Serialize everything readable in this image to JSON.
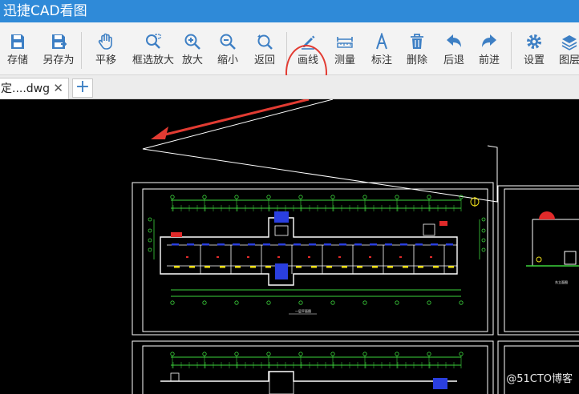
{
  "window": {
    "title": "迅捷CAD看图"
  },
  "toolbar": {
    "buttons": [
      {
        "key": "save",
        "label": "存储",
        "icon": "save-icon"
      },
      {
        "key": "save-as",
        "label": "另存为",
        "icon": "save-as-icon"
      },
      {
        "key": "pan",
        "label": "平移",
        "icon": "hand-icon"
      },
      {
        "key": "zoom-window",
        "label": "框选放大",
        "icon": "zoom-window-icon"
      },
      {
        "key": "zoom-in",
        "label": "放大",
        "icon": "zoom-in-icon"
      },
      {
        "key": "zoom-out",
        "label": "缩小",
        "icon": "zoom-out-icon"
      },
      {
        "key": "back",
        "label": "返回",
        "icon": "zoom-previous-icon"
      },
      {
        "key": "draw-line",
        "label": "画线",
        "icon": "pencil-icon"
      },
      {
        "key": "measure",
        "label": "测量",
        "icon": "ruler-icon"
      },
      {
        "key": "annotate",
        "label": "标注",
        "icon": "text-a-icon"
      },
      {
        "key": "delete",
        "label": "删除",
        "icon": "trash-icon"
      },
      {
        "key": "undo",
        "label": "后退",
        "icon": "undo-arrow-icon"
      },
      {
        "key": "redo",
        "label": "前进",
        "icon": "redo-arrow-icon"
      },
      {
        "key": "settings",
        "label": "设置",
        "icon": "gear-icon"
      },
      {
        "key": "layers",
        "label": "图层",
        "icon": "layers-icon"
      }
    ],
    "active_highlight": "#e23b32",
    "accent": "#3d7fc4"
  },
  "tabs": {
    "items": [
      {
        "name": "定....dwg",
        "close": "✕"
      }
    ],
    "add": "+"
  },
  "drawing": {
    "floor_plan_title": "一层平面图",
    "elevation_title": "东立面图"
  },
  "watermark": "@51CTO博客",
  "colors": {
    "titlebar": "#2f8ad8",
    "canvas": "#000000",
    "cad_green": "#3cd43c",
    "cad_white": "#ffffff",
    "cad_blue": "#2a3fe0",
    "cad_yellow": "#f2e21a",
    "cad_red": "#e02a2a"
  }
}
